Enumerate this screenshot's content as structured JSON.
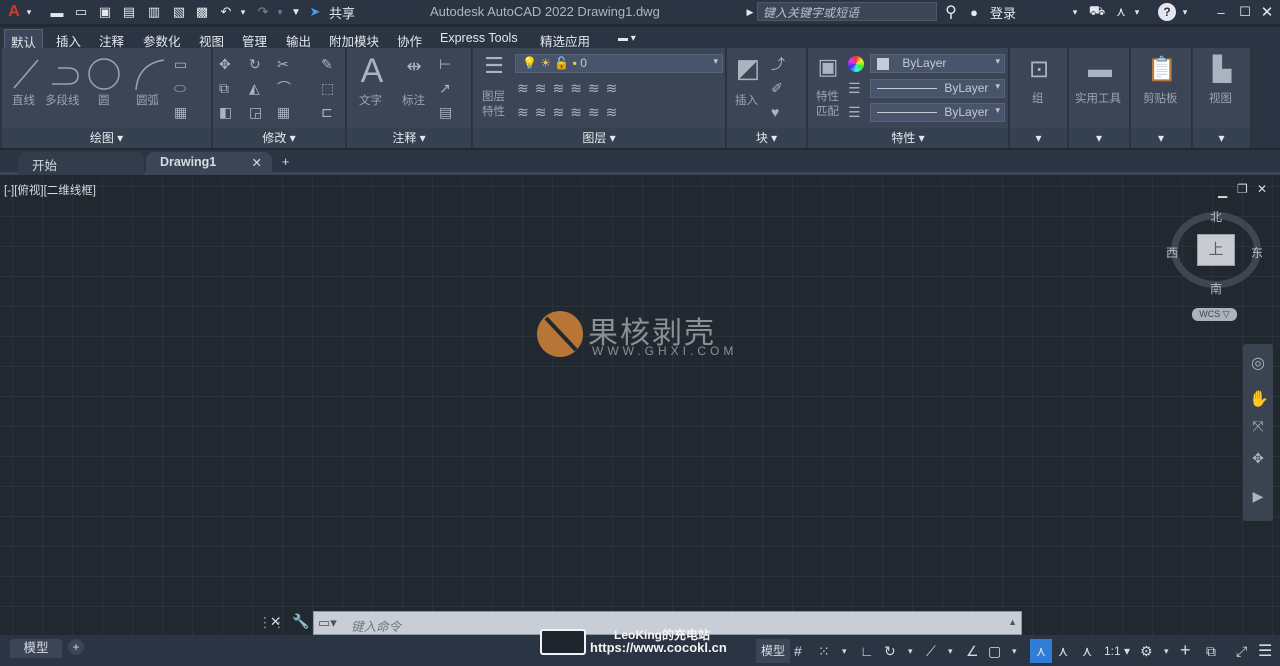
{
  "title_bar": {
    "app_icon": "autocad-logo",
    "share_label": "共享",
    "title": "Autodesk AutoCAD 2022    Drawing1.dwg",
    "search_placeholder": "键入关键字或短语",
    "login_label": "登录",
    "quick_access_icons": [
      "new-icon",
      "open-icon",
      "save-icon",
      "save-as-icon",
      "publish-icon",
      "export-icon",
      "print-icon",
      "undo-icon",
      "redo-icon"
    ]
  },
  "ribbon_tabs": [
    "默认",
    "插入",
    "注释",
    "参数化",
    "视图",
    "管理",
    "输出",
    "附加模块",
    "协作",
    "Express Tools",
    "精选应用"
  ],
  "ribbon": {
    "draw": {
      "title": "绘图 ▾",
      "tools": [
        "直线",
        "多段线",
        "圆",
        "圆弧"
      ]
    },
    "modify": {
      "title": "修改 ▾"
    },
    "annotate": {
      "title": "注释 ▾",
      "tools": [
        "文字",
        "标注"
      ]
    },
    "layers": {
      "title": "图层 ▾",
      "layer_props": "图层\n特性",
      "layer_value": "0"
    },
    "block": {
      "title": "块 ▾",
      "insert": "插入"
    },
    "properties": {
      "title": "特性 ▾",
      "match": "特性\n匹配",
      "color": "ByLayer",
      "linetype": "ByLayer",
      "lineweight": "ByLayer"
    },
    "groups": {
      "title": "▾",
      "label": "组"
    },
    "utilities": {
      "title": "▾",
      "label": "实用工具"
    },
    "clipboard": {
      "title": "▾",
      "label": "剪贴板"
    },
    "view": {
      "title": "▾",
      "label": "视图"
    }
  },
  "doc_tabs": {
    "start": "开始",
    "drawing": "Drawing1",
    "add": "+"
  },
  "viewport": {
    "label": "[-][俯视][二维线框]",
    "watermark_title": "果核剥壳",
    "watermark_url": "WWW.GHXI.COM",
    "viewcube": {
      "north": "北",
      "south": "南",
      "east": "东",
      "west": "西",
      "face": "上",
      "wcs": "WCS ▽"
    }
  },
  "command_line": {
    "placeholder": "键入命令"
  },
  "status_bar": {
    "layout_tab": "模型",
    "add": "+",
    "model": "模型",
    "scale": "1:1 ▾",
    "overlay_title": "LeoKing的充电站",
    "overlay_url": "https://www.cocokl.cn"
  },
  "colors": {
    "background": "#212830",
    "ribbon": "#3b4556",
    "accent_blue": "#2f7dd6",
    "watermark": "#b87636"
  }
}
